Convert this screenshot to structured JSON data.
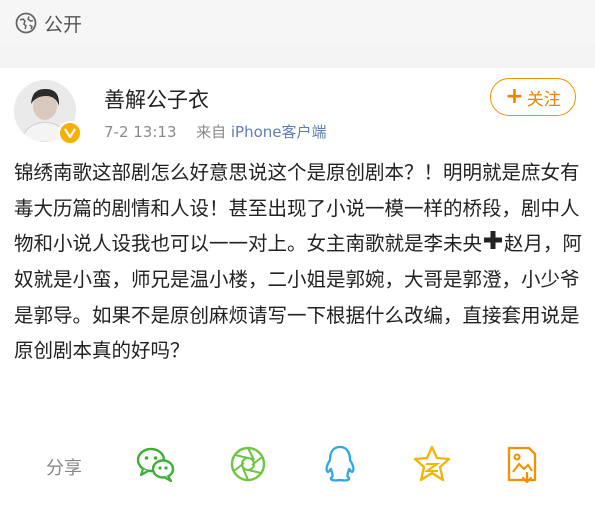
{
  "header": {
    "visibility_label": "公开"
  },
  "author": {
    "name": "善解公子衣",
    "date": "7-2 13:13",
    "source_prefix": "来自",
    "source": "iPhone客户端",
    "follow_label": "关注"
  },
  "post": {
    "text_before_emoji": "锦绣南歌这部剧怎么好意思说这个是原创剧本？！明明就是庶女有毒大历篇的剧情和人设！甚至出现了小说一模一样的桥段，剧中人物和小说人设我也可以一一对上。女主南歌就是李未央",
    "text_after_emoji": "赵月，阿奴就是小蛮，师兄是温小楼，二小姐是郭婉，大哥是郭澄，小少爷是郭导。如果不是原创麻烦请写一下根据什么改编，直接套用说是原创剧本真的好吗？"
  },
  "share": {
    "label": "分享",
    "targets": [
      "wechat-icon",
      "moments-icon",
      "qq-icon",
      "qzone-icon",
      "save-image-icon"
    ]
  },
  "colors": {
    "accent": "#f08300",
    "wechat": "#3cb034",
    "moments": "#6cc63e",
    "qq": "#2ba7e6",
    "qzone": "#f5b400",
    "save": "#f29100"
  }
}
